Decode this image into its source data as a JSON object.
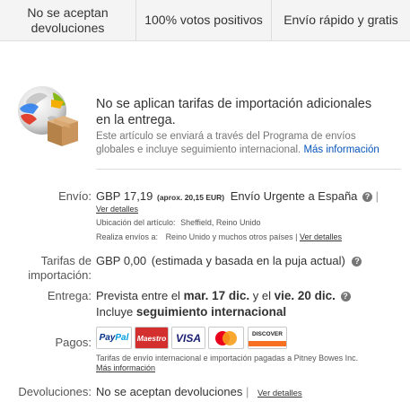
{
  "badges": [
    {
      "line1": "No se aceptan",
      "line2": "devoluciones"
    },
    {
      "line1": "100% votos positivos"
    },
    {
      "line1": "Envío rápido y gratis"
    }
  ],
  "gsp": {
    "icon": "globe-box-icon",
    "title_line1": "No se aplican tarifas de importación adicionales",
    "title_line2": "en la entrega.",
    "desc_line1": "Este artículo se enviará a través del Programa de envíos",
    "desc_line2": "globales e incluye seguimiento internacional.",
    "more_link": "Más información"
  },
  "shipping": {
    "label": "Envío:",
    "price": "GBP 17,19",
    "approx": "(aprox. 20,15 EUR)",
    "service": "Envío Urgente a España",
    "pipe": "|",
    "details_link": "Ver detalles",
    "location_label": "Ubicación del artículo:",
    "location_value": "Sheffield, Reino Unido",
    "ships_to_label": "Realiza envíos a:",
    "ships_to_value": "Reino Unido y muchos otros países",
    "ships_to_pipe": "|",
    "ships_to_link": "Ver detalles"
  },
  "import_fees": {
    "label_line1": "Tarifas de",
    "label_line2": "importación:",
    "price": "GBP 0,00",
    "note": "(estimada y basada en la puja actual)"
  },
  "delivery": {
    "label": "Entrega:",
    "prefix": "Prevista entre el",
    "date1": "mar. 17 dic.",
    "middle": "y el",
    "date2": "vie. 20 dic.",
    "line2_prefix": "Incluye",
    "line2_bold": "seguimiento internacional"
  },
  "payments": {
    "label": "Pagos:",
    "logos": [
      "PayPal",
      "Maestro",
      "VISA",
      "Mastercard",
      "DISCOVER"
    ],
    "note": "Tarifas de envío internacional e importación pagadas a Pitney Bowes Inc.",
    "more_link": "Más información"
  },
  "returns": {
    "label": "Devoluciones:",
    "value": "No se aceptan devoluciones",
    "pipe": "|",
    "details_link": "Ver detalles"
  },
  "colors": {
    "link": "#0654ba",
    "badge_bg": "#f4f4f4",
    "paypal_blue": "#003087",
    "paypal_light": "#009cde",
    "maestro_bg": "#d32f2f",
    "visa_blue": "#1a1f71",
    "mc_red": "#eb001b",
    "mc_orange": "#f79e1b",
    "discover_orange": "#f76f20"
  }
}
